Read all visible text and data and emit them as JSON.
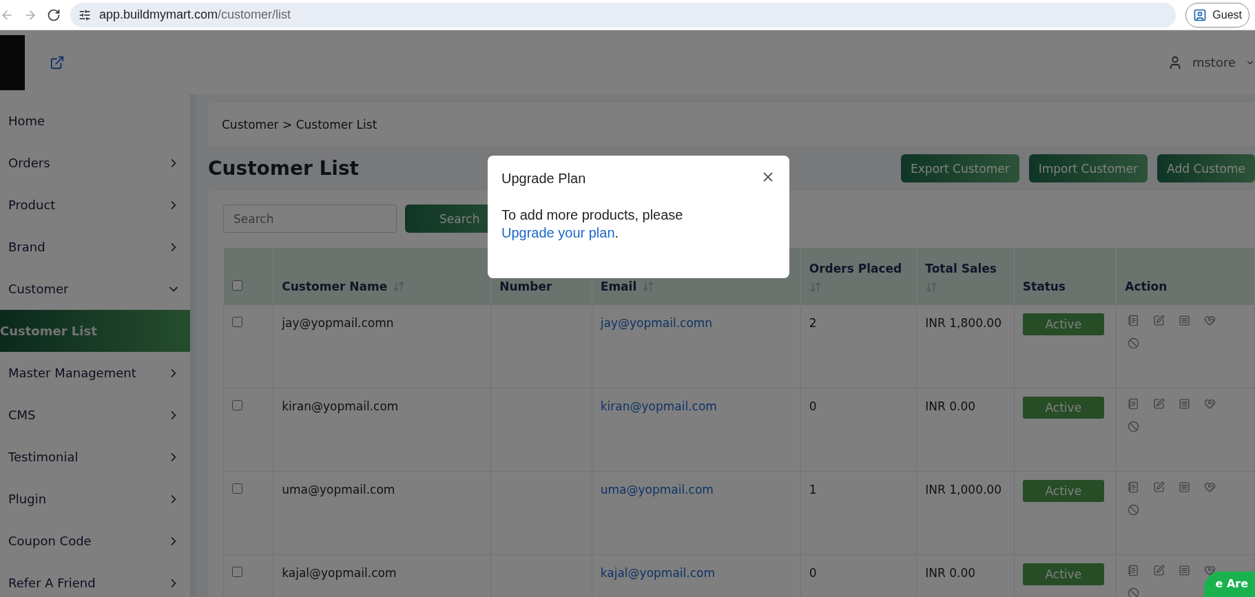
{
  "browser": {
    "url_host": "app.buildmymart.com",
    "url_path": "/customer/list",
    "profile": "Guest"
  },
  "header": {
    "user": "mstore"
  },
  "sidebar": {
    "items": [
      {
        "label": "Home",
        "selected": false,
        "expanded": false,
        "has_children": false
      },
      {
        "label": "Orders",
        "selected": false,
        "expanded": false,
        "has_children": true
      },
      {
        "label": "Product",
        "selected": false,
        "expanded": false,
        "has_children": true
      },
      {
        "label": "Brand",
        "selected": false,
        "expanded": false,
        "has_children": true
      },
      {
        "label": "Customer",
        "selected": false,
        "expanded": true,
        "has_children": true,
        "children": [
          {
            "label": "Customer List",
            "selected": true
          }
        ]
      },
      {
        "label": "Master Management",
        "selected": false,
        "expanded": false,
        "has_children": true
      },
      {
        "label": "CMS",
        "selected": false,
        "expanded": false,
        "has_children": true
      },
      {
        "label": "Testimonial",
        "selected": false,
        "expanded": false,
        "has_children": true
      },
      {
        "label": "Plugin",
        "selected": false,
        "expanded": false,
        "has_children": true
      },
      {
        "label": "Coupon Code",
        "selected": false,
        "expanded": false,
        "has_children": true
      },
      {
        "label": "Refer A Friend",
        "selected": false,
        "expanded": false,
        "has_children": true
      }
    ]
  },
  "breadcrumb": [
    "Customer",
    "Customer List"
  ],
  "breadcrumb_separator": ">",
  "page_title": "Customer List",
  "actions": [
    "Export Customer",
    "Import Customer",
    "Add Custome"
  ],
  "search": {
    "placeholder": "Search",
    "button": "Search"
  },
  "table": {
    "select_all": false,
    "columns": [
      {
        "label": "Customer Name",
        "sortable": true
      },
      {
        "label": "Number",
        "sortable": false
      },
      {
        "label": "Email",
        "sortable": true
      },
      {
        "label": "Orders Placed",
        "sortable": true
      },
      {
        "label": "Total Sales",
        "sortable": true
      },
      {
        "label": "Status",
        "sortable": false
      },
      {
        "label": "Action",
        "sortable": false
      }
    ],
    "rows": [
      {
        "checked": false,
        "name": "jay@yopmail.comn",
        "number": "",
        "email": "jay@yopmail.comn",
        "orders": "2",
        "sales": "INR 1,800.00",
        "status": "Active"
      },
      {
        "checked": false,
        "name": "kiran@yopmail.com",
        "number": "",
        "email": "kiran@yopmail.com",
        "orders": "0",
        "sales": "INR 0.00",
        "status": "Active"
      },
      {
        "checked": false,
        "name": "uma@yopmail.com",
        "number": "",
        "email": "uma@yopmail.com",
        "orders": "1",
        "sales": "INR 1,000.00",
        "status": "Active"
      },
      {
        "checked": false,
        "name": "kajal@yopmail.com",
        "number": "",
        "email": "kajal@yopmail.com",
        "orders": "0",
        "sales": "INR 0.00",
        "status": "Active"
      }
    ]
  },
  "modal": {
    "open": true,
    "title": "Upgrade Plan",
    "body": "To add more products, please ",
    "link": "Upgrade your plan",
    "after": "."
  },
  "chat_widget": {
    "text": "e Are"
  }
}
